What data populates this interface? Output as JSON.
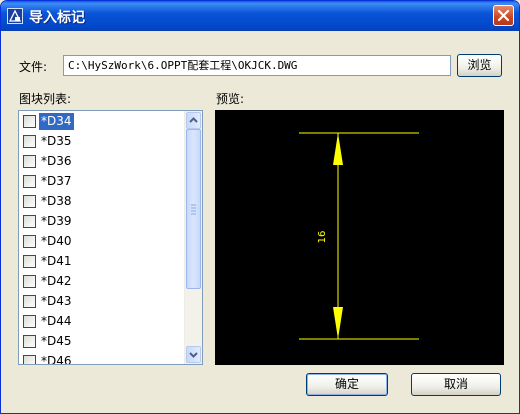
{
  "window": {
    "title": "导入标记",
    "close": "close"
  },
  "file": {
    "label": "文件:",
    "value": "C:\\HySzWork\\6.OPPT配套工程\\OKJCK.DWG",
    "browse_label": "浏览"
  },
  "blocks": {
    "label": "图块列表:",
    "items": [
      {
        "name": "*D34",
        "checked": false,
        "selected": true
      },
      {
        "name": "*D35",
        "checked": false
      },
      {
        "name": "*D36",
        "checked": false
      },
      {
        "name": "*D37",
        "checked": false
      },
      {
        "name": "*D38",
        "checked": false
      },
      {
        "name": "*D39",
        "checked": false
      },
      {
        "name": "*D40",
        "checked": false
      },
      {
        "name": "*D41",
        "checked": false
      },
      {
        "name": "*D42",
        "checked": false
      },
      {
        "name": "*D43",
        "checked": false
      },
      {
        "name": "*D44",
        "checked": false
      },
      {
        "name": "*D45",
        "checked": false
      },
      {
        "name": "*D46",
        "checked": false
      }
    ]
  },
  "preview": {
    "label": "预览:",
    "dimension_text": "16",
    "line_color": "#ffff00",
    "background": "#000000"
  },
  "buttons": {
    "ok": "确定",
    "cancel": "取消"
  }
}
